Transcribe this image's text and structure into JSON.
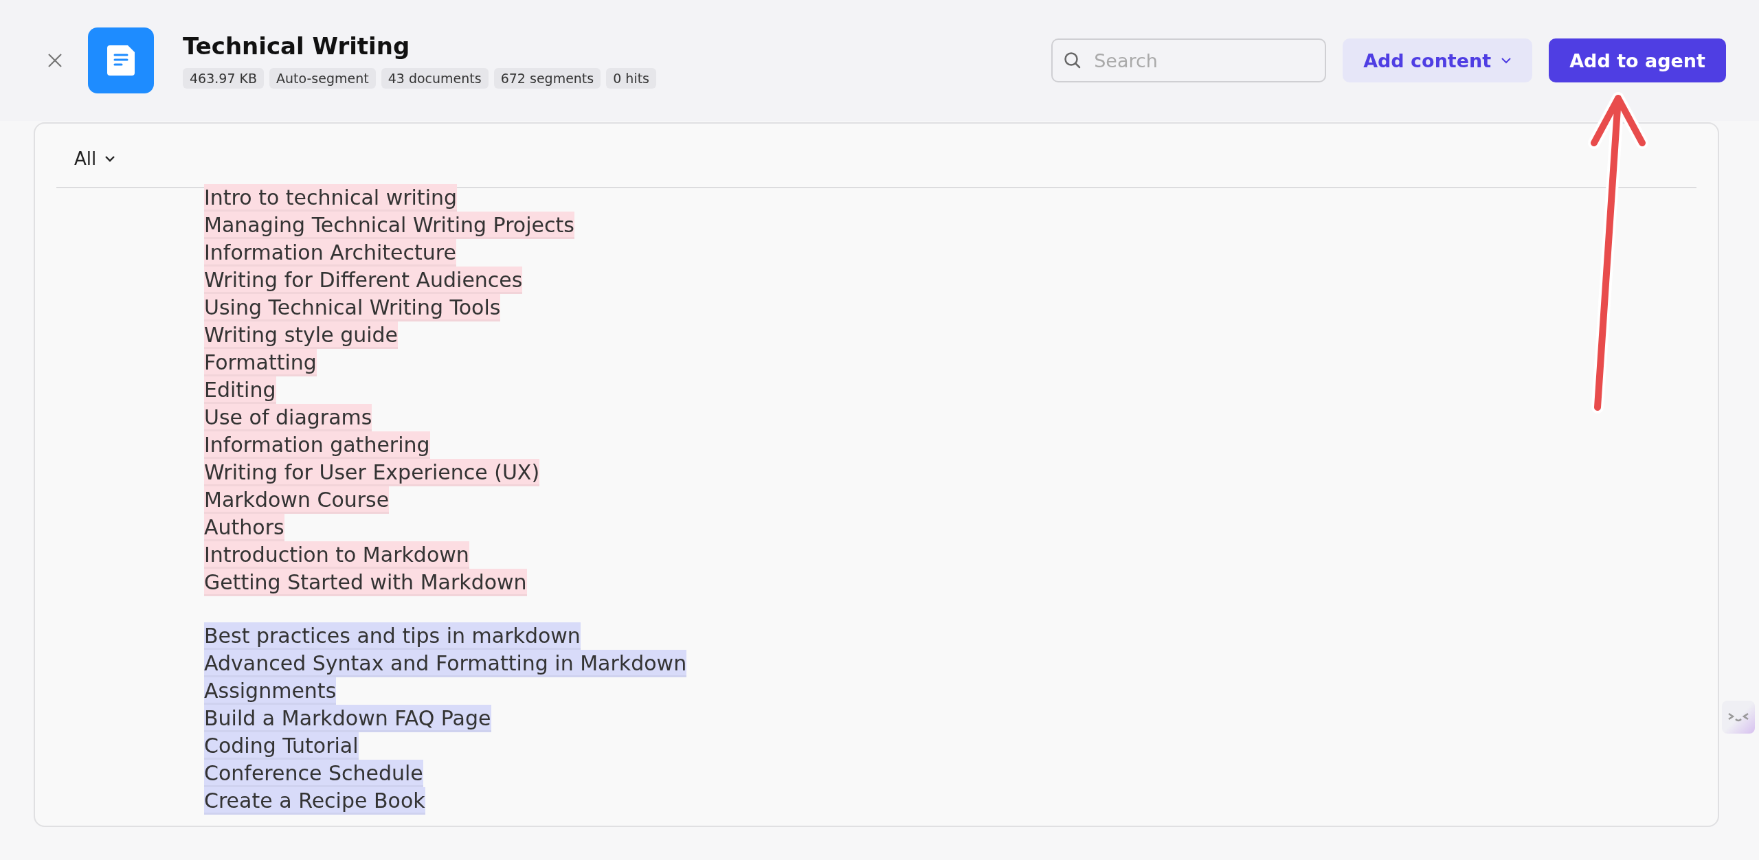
{
  "header": {
    "title": "Technical Writing",
    "tags": [
      "463.97 KB",
      "Auto-segment",
      "43 documents",
      "672 segments",
      "0 hits"
    ],
    "search": {
      "placeholder": "Search"
    },
    "add_content": "Add content",
    "add_to_agent": "Add to agent"
  },
  "filter": {
    "label": "All"
  },
  "segments": [
    {
      "color": "#fcdde2",
      "items": [
        "Intro to technical writing",
        "Managing Technical Writing Projects",
        "Information Architecture",
        "Writing for Different Audiences",
        "Using Technical Writing Tools",
        "Writing style guide",
        "Formatting",
        "Editing",
        "Use of diagrams",
        "Information gathering",
        "Writing for User Experience (UX)",
        "Markdown Course",
        "Authors",
        "Introduction to Markdown",
        "Getting Started with Markdown"
      ]
    },
    {
      "color": "#d8dbf9",
      "items": [
        "Best practices and tips in markdown",
        "Advanced Syntax and Formatting in Markdown",
        "Assignments",
        "Build a Markdown FAQ Page",
        "Coding Tutorial",
        "Conference Schedule",
        "Create a Recipe Book"
      ]
    }
  ]
}
